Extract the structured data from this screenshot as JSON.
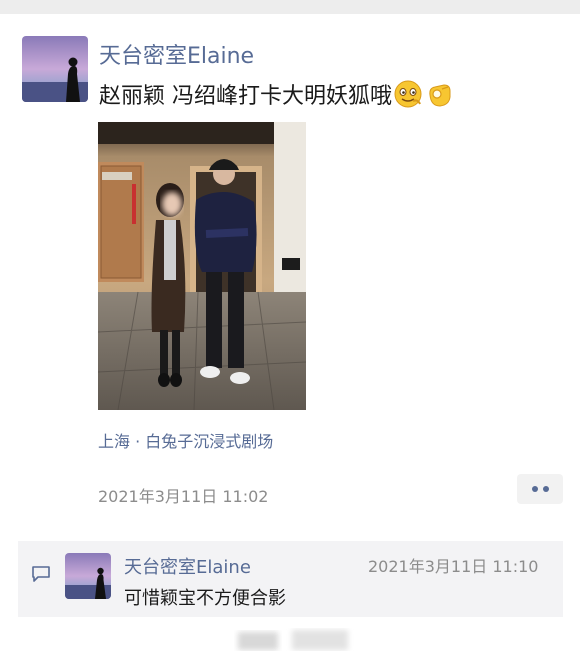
{
  "post": {
    "author": "天台密室Elaine",
    "text": "赵丽颖 冯绍峰打卡大明妖狐哦",
    "emojis": [
      "smiling-face-emoji",
      "ok-hand-emoji"
    ],
    "photo": "photo of two people posing in front of a venue entrance",
    "location": "上海 · 白兔子沉浸式剧场",
    "time": "2021年3月11日 11:02"
  },
  "comment": {
    "author": "天台密室Elaine",
    "time": "2021年3月11日 11:10",
    "text": "可惜颖宝不方便合影"
  },
  "colors": {
    "link": "#576b95",
    "text": "#1a1a1a",
    "meta": "#8c8c8c",
    "comment_bg": "#f3f3f5"
  }
}
